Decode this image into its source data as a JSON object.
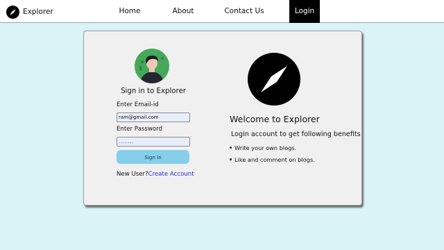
{
  "navbar": {
    "brand_name": "Explorer",
    "brand_icon": "compass-icon",
    "links": {
      "home": "Home",
      "about": "About",
      "contact": "Contact Us",
      "login": "Login"
    },
    "active_link": "login"
  },
  "login_form": {
    "avatar_icon": "user-avatar-icon",
    "title": "Sign in to Explorer",
    "email_label": "Enter Email-id",
    "email_value": "ram@gmail.com",
    "password_label": "Enter Password",
    "password_value": "........",
    "signin_label": "Sign in",
    "new_user_text": "New User?",
    "create_account_label": "Create Account"
  },
  "welcome_panel": {
    "icon": "compass-icon",
    "title": "Welcome to Explorer",
    "benefits_title": "Login account to get following benefits",
    "benefits": [
      "Write your own blogs.",
      "Like and comment on blogs."
    ]
  },
  "colors": {
    "page_background": "#d9f3f7",
    "card_background": "#f0f0f0",
    "active_nav": "#000000",
    "signin_button": "#85cfea",
    "link": "#2b2bd6",
    "avatar_background": "#45a85a"
  }
}
